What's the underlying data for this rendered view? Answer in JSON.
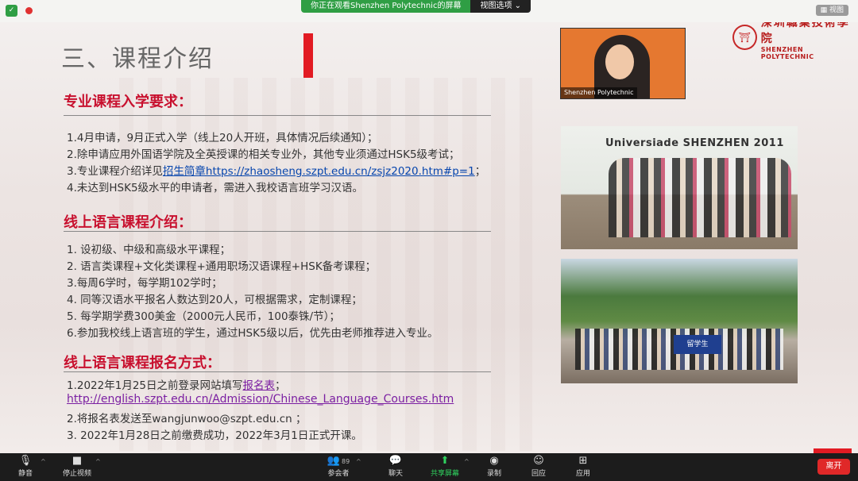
{
  "top_bar": {
    "viewing_message": "你正在观看Shenzhen Polytechnic的屏幕",
    "view_options": "视图选项 ⌄",
    "view_button": "视图",
    "icons": [
      "shield-icon",
      "record-dot-icon"
    ]
  },
  "slide": {
    "title": "三、课程介绍",
    "logo_cn": "深圳職業技術學院",
    "logo_en": "SHENZHEN POLYTECHNIC",
    "section1": {
      "heading": "专业课程入学要求：",
      "lines": [
        "1.4月申请，9月正式入学（线上20人开班，具体情况后续通知）；",
        "2.除申请应用外国语学院及全英授课的相关专业外，其他专业须通过HSK5级考试；",
        "4.未达到HSK5级水平的申请者，需进入我校语言班学习汉语。"
      ],
      "line3_prefix": "3.专业课程介绍详见",
      "line3_link": "招生简章https://zhaosheng.szpt.edu.cn/zsjz2020.htm#p=1",
      "line3_suffix": "；"
    },
    "section2": {
      "heading": "线上语言课程介绍：",
      "lines": [
        "1. 设初级、中级和高级水平课程；",
        "2. 语言类课程+文化类课程+通用职场汉语课程+HSK备考课程；",
        "3.每周6学时，每学期102学时；",
        "4. 同等汉语水平报名人数达到20人，可根据需求，定制课程；",
        "5. 每学期学费300美金（2000元人民币，100泰铢/节）；",
        "6.参加我校线上语言班的学生，通过HSK5级以后，优先由老师推荐进入专业。"
      ]
    },
    "section3": {
      "heading": "线上语言课程报名方式：",
      "line1_prefix": "1.2022年1月25日之前登录网站填写",
      "line1_link": "报名表",
      "line1_suffix": "；",
      "url": "http://english.szpt.edu.cn/Admission/Chinese_Language_Courses.htm",
      "line2": "2.将报名表发送至wangjunwoo@szpt.edu.cn ；",
      "line3": "3. 2022年1月28日之前缴费成功，2022年3月1日正式开课。"
    },
    "video_label": "Shenzhen Polytechnic",
    "photo1_text": "Universiade SHENZHEN 2011",
    "photo2_banner": "留学生"
  },
  "toolbar": {
    "mute": "静音",
    "stop_video": "停止视频",
    "participants": "参会者",
    "participant_count": "89",
    "chat": "聊天",
    "share": "共享屏幕",
    "record": "录制",
    "reactions": "回应",
    "apps": "应用",
    "leave": "离开"
  },
  "colors": {
    "accent_red": "#e21b23",
    "heading_red": "#c8102e",
    "share_green": "#2fd35f",
    "banner_green": "#2f9e44"
  }
}
